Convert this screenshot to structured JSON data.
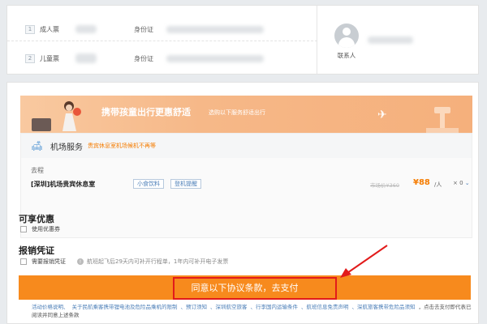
{
  "passengers": [
    {
      "num": "1",
      "type": "成人票",
      "id_label": "身份证"
    },
    {
      "num": "2",
      "type": "儿童票",
      "id_label": "身份证"
    }
  ],
  "contact": {
    "label": "联系人"
  },
  "banner": {
    "title": "携带孩童出行更惠舒适",
    "subtitle": "选购以下服务舒适出行"
  },
  "service": {
    "title": "机场服务",
    "subtitle": "贵宾休息室机场候机不再等",
    "trip_label": "去程",
    "item_name": "[深圳]机场贵宾休息室",
    "tags": [
      "小食饮料",
      "登机提醒"
    ],
    "original_price": "市场价¥360",
    "price": "¥88",
    "per": "/人",
    "qty": "× 0"
  },
  "discount": {
    "title": "可享优惠",
    "checkbox_label": "使用优惠券"
  },
  "invoice": {
    "title": "报销凭证",
    "checkbox_label": "需要报销凭证",
    "note": "航班起飞后29天内可补开行程单，1年内可补开电子发票"
  },
  "pay_button": {
    "label": "同意以下协议条款，去支付"
  },
  "notice": {
    "links": [
      "活动价格说明、",
      "关于民航乘客携带锂电池及危险品乘机的限制",
      "、预订须知",
      "、深圳航空旅客",
      "、行李国内运输条件",
      "、航班信息免责声明",
      "、深航旅客携带危险品须知"
    ],
    "tail": "，点击去支付即代表已阅读并同意上述条款"
  },
  "colors": {
    "accent": "#f78a1d",
    "highlight": "#e21b1b",
    "link": "#4a7db7"
  }
}
